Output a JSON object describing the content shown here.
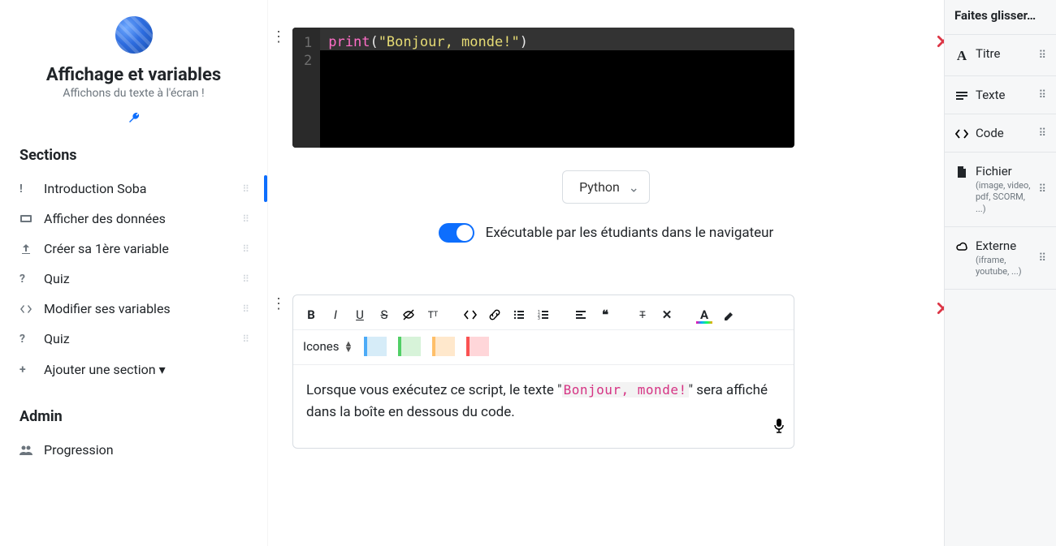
{
  "course": {
    "title": "Affichage et variables",
    "subtitle": "Affichons du texte à l'écran !"
  },
  "sidebar": {
    "sections_heading": "Sections",
    "items": [
      {
        "icon": "exclaim",
        "label": "Introduction Soba",
        "active": true
      },
      {
        "icon": "display",
        "label": "Afficher des données"
      },
      {
        "icon": "upload",
        "label": "Créer sa 1ère variable"
      },
      {
        "icon": "question",
        "label": "Quiz"
      },
      {
        "icon": "codeang",
        "label": "Modifier ses variables"
      },
      {
        "icon": "question",
        "label": "Quiz"
      }
    ],
    "add_section": "Ajouter une section",
    "admin_heading": "Admin",
    "admin_items": [
      {
        "icon": "users",
        "label": "Progression"
      }
    ]
  },
  "editor": {
    "code": {
      "lines": [
        "1",
        "2"
      ],
      "fn": "print",
      "paren_open": "(",
      "string": "\"Bonjour, monde!\"",
      "paren_close": ")"
    },
    "language": "Python",
    "exec_label": "Exécutable par les étudiants dans le navigateur",
    "rte": {
      "icones_label": "Icones",
      "text_before": "Lorsque vous exécutez ce script, le texte \"",
      "inline_code": "Bonjour, monde!",
      "text_after": "\" sera affiché dans la boîte en dessous du code."
    }
  },
  "palette": {
    "heading": "Faites glisser…",
    "items": [
      {
        "icon": "type",
        "label": "Titre"
      },
      {
        "icon": "text",
        "label": "Texte"
      },
      {
        "icon": "code",
        "label": "Code"
      },
      {
        "icon": "file",
        "label": "Fichier",
        "sub": "(image, video, pdf, SCORM, ...)"
      },
      {
        "icon": "cloud",
        "label": "Externe",
        "sub": "(iframe, youtube, ...)"
      }
    ]
  }
}
